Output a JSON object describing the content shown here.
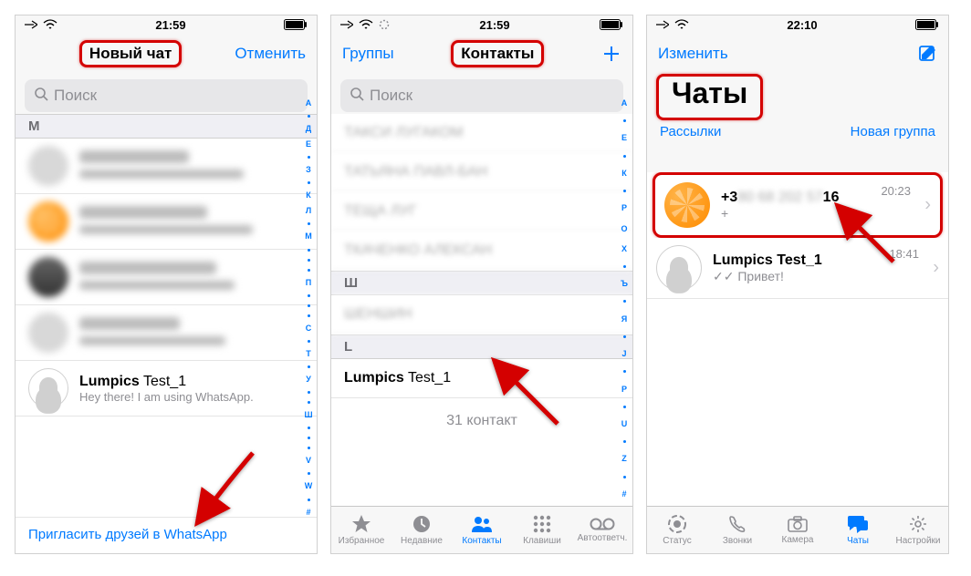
{
  "status": {
    "time": "21:59",
    "time3": "22:10"
  },
  "panel1": {
    "nav_title": "Новый чат",
    "nav_cancel": "Отменить",
    "search_placeholder": "Поиск",
    "section_letter": "М",
    "contact_clear_name_strong": "Lumpics",
    "contact_clear_name_rest": " Test_1",
    "contact_clear_sub": "Hey there! I am using WhatsApp.",
    "footer_invite": "Пригласить друзей в WhatsApp",
    "index": [
      "А",
      "",
      "Д",
      "Е",
      "",
      "З",
      "",
      "К",
      "Л",
      "",
      "М",
      "",
      "",
      "",
      "П",
      "",
      "",
      "",
      "С",
      "",
      "Т",
      "",
      "У",
      "",
      "",
      "Ш",
      "",
      "",
      "",
      "V",
      "",
      "W",
      "",
      "#"
    ]
  },
  "panel2": {
    "nav_left": "Группы",
    "nav_title": "Контакты",
    "search_placeholder": "Поиск",
    "section_letter": "L",
    "contact_strong": "Lumpics",
    "contact_rest": " Test_1",
    "count": "31 контакт",
    "index": [
      "А",
      "",
      "Е",
      "",
      "К",
      "",
      "Р",
      "О",
      "Х",
      "",
      "Ъ",
      "",
      "Я",
      "",
      "J",
      "",
      "P",
      "",
      "U",
      "",
      "Z",
      "",
      "#"
    ],
    "tabs": {
      "fav": "Избранное",
      "recent": "Недавние",
      "contacts": "Контакты",
      "keypad": "Клавиши",
      "voicemail": "Автоответч."
    }
  },
  "panel3": {
    "nav_left": "Изменить",
    "large_title": "Чаты",
    "sub_left": "Рассылки",
    "sub_right": "Новая группа",
    "chat1_prefix": "+3",
    "chat1_suffix": "16",
    "chat1_sub": "+",
    "chat1_time": "20:23",
    "chat2_name": "Lumpics Test_1",
    "chat2_sub": "✓✓ Привет!",
    "chat2_time": "18:41",
    "tabs": {
      "status": "Статус",
      "calls": "Звонки",
      "camera": "Камера",
      "chats": "Чаты",
      "settings": "Настройки"
    }
  }
}
